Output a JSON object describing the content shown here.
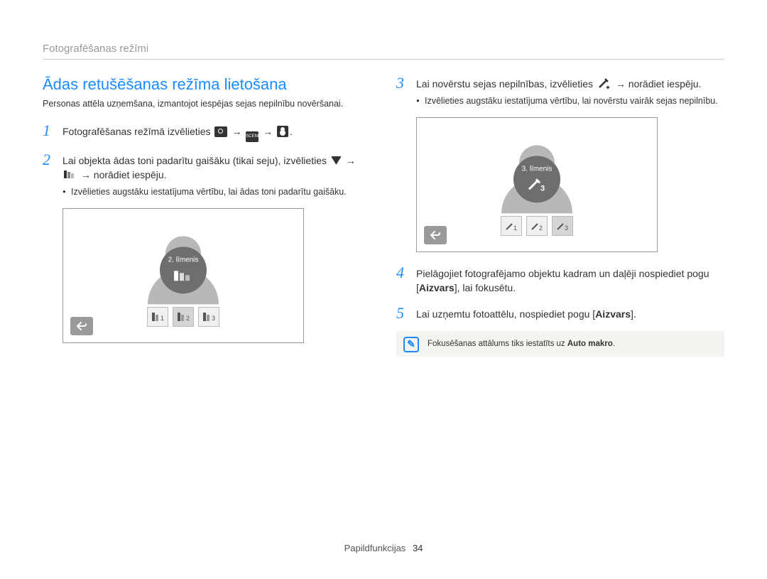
{
  "header": "Fotografēšanas režīmi",
  "title": "Ādas retušēšanas režīma lietošana",
  "intro": "Personas attēla uzņemšana, izmantojot iespējas sejas nepilnību novēršanai.",
  "steps_left": {
    "s1": "Fotografēšanas režīmā izvēlieties ",
    "s2a": "Lai objekta ādas toni padarītu gaišāku (tikai seju), izvēlieties ",
    "s2b": "→ norādiet iespēju.",
    "s2_bullet": "Izvēlieties augstāku iestatījuma vērtību, lai ādas toni padarītu gaišāku."
  },
  "steps_right": {
    "s3a": "Lai novērstu sejas nepilnības, izvēlieties ",
    "s3b": "→ norādiet iespēju.",
    "s3_bullet": "Izvēlieties augstāku iestatījuma vērtību, lai novērstu vairāk sejas nepilnību.",
    "s4a": "Pielāgojiet fotografējamo objektu kadram un daļēji nospiediet pogu [",
    "s4b": "Aizvars",
    "s4c": "], lai fokusētu.",
    "s5a": "Lai uzņemtu fotoattēlu, nospiediet pogu [",
    "s5b": "Aizvars",
    "s5c": "]."
  },
  "screen1": {
    "level_label": "2. līmenis"
  },
  "screen2": {
    "level_label": "3. līmenis"
  },
  "note": {
    "text_a": "Fokusēšanas attālums tiks iestatīts uz ",
    "text_bold": "Auto makro",
    "text_b": "."
  },
  "footer": {
    "section": "Papildfunkcijas",
    "page": "34"
  },
  "arrow": "→"
}
